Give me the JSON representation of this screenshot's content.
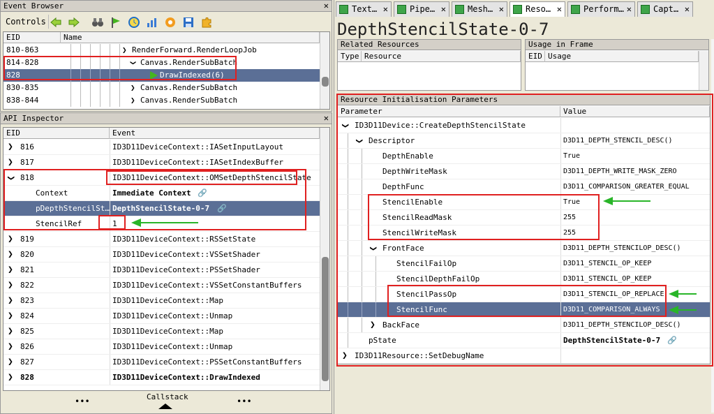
{
  "event_browser": {
    "title": "Event Browser",
    "close": "✕",
    "controls_label": "Controls",
    "columns": [
      "EID",
      "Name"
    ],
    "rows": [
      {
        "eid": "810-863",
        "name": "RenderForward.RenderLoopJob",
        "chev": "❯"
      },
      {
        "eid": "814-828",
        "name": "Canvas.RenderSubBatch",
        "chev": "❯"
      },
      {
        "eid": "828",
        "name": "DrawIndexed(6)"
      },
      {
        "eid": "830-835",
        "name": "Canvas.RenderSubBatch",
        "chev": "❯"
      },
      {
        "eid": "838-844",
        "name": "Canvas.RenderSubBatch",
        "chev": "❯"
      }
    ]
  },
  "api_inspector": {
    "title": "API Inspector",
    "close": "✕",
    "columns": [
      "EID",
      "Event"
    ],
    "rows": [
      {
        "eid": "816",
        "event": "ID3D11DeviceContext::IASetInputLayout"
      },
      {
        "eid": "817",
        "event": "ID3D11DeviceContext::IASetIndexBuffer"
      },
      {
        "eid": "818",
        "event": "ID3D11DeviceContext::OMSetDepthStencilState"
      },
      {
        "param": "Context",
        "value": "Immediate Context"
      },
      {
        "param": "pDepthStencilSt…",
        "value": "DepthStencilState-0-7"
      },
      {
        "param": "StencilRef",
        "value": "1"
      },
      {
        "eid": "819",
        "event": "ID3D11DeviceContext::RSSetState"
      },
      {
        "eid": "820",
        "event": "ID3D11DeviceContext::VSSetShader"
      },
      {
        "eid": "821",
        "event": "ID3D11DeviceContext::PSSetShader"
      },
      {
        "eid": "822",
        "event": "ID3D11DeviceContext::VSSetConstantBuffers"
      },
      {
        "eid": "823",
        "event": "ID3D11DeviceContext::Map"
      },
      {
        "eid": "824",
        "event": "ID3D11DeviceContext::Unmap"
      },
      {
        "eid": "825",
        "event": "ID3D11DeviceContext::Map"
      },
      {
        "eid": "826",
        "event": "ID3D11DeviceContext::Unmap"
      },
      {
        "eid": "827",
        "event": "ID3D11DeviceContext::PSSetConstantBuffers"
      },
      {
        "eid": "828",
        "event": "ID3D11DeviceContext::DrawIndexed"
      }
    ],
    "callstack": "Callstack",
    "dots": "•••"
  },
  "tabs": [
    {
      "label": "Text…",
      "close": "✕"
    },
    {
      "label": "Pipe…",
      "close": "✕"
    },
    {
      "label": "Mesh…",
      "close": "✕"
    },
    {
      "label": "Reso…",
      "close": "✕"
    },
    {
      "label": "Perform…",
      "close": "✕"
    },
    {
      "label": "Capt…",
      "close": "✕"
    }
  ],
  "resource": {
    "name": "DepthStencilState-0-7",
    "related_title": "Related Resources",
    "related_cols": [
      "Type",
      "Resource"
    ],
    "usage_title": "Usage in Frame",
    "usage_cols": [
      "EID",
      "Usage"
    ],
    "init_title": "Resource Initialisation Parameters",
    "init_cols": [
      "Parameter",
      "Value"
    ],
    "params": [
      {
        "param": "ID3D11Device::CreateDepthStencilState",
        "value": ""
      },
      {
        "param": "Descriptor",
        "value": "D3D11_DEPTH_STENCIL_DESC()"
      },
      {
        "param": "DepthEnable",
        "value": "True"
      },
      {
        "param": "DepthWriteMask",
        "value": "D3D11_DEPTH_WRITE_MASK_ZERO"
      },
      {
        "param": "DepthFunc",
        "value": "D3D11_COMPARISON_GREATER_EQUAL"
      },
      {
        "param": "StencilEnable",
        "value": "True"
      },
      {
        "param": "StencilReadMask",
        "value": "255"
      },
      {
        "param": "StencilWriteMask",
        "value": "255"
      },
      {
        "param": "FrontFace",
        "value": "D3D11_DEPTH_STENCILOP_DESC()"
      },
      {
        "param": "StencilFailOp",
        "value": "D3D11_STENCIL_OP_KEEP"
      },
      {
        "param": "StencilDepthFailOp",
        "value": "D3D11_STENCIL_OP_KEEP"
      },
      {
        "param": "StencilPassOp",
        "value": "D3D11_STENCIL_OP_REPLACE"
      },
      {
        "param": "StencilFunc",
        "value": "D3D11_COMPARISON_ALWAYS"
      },
      {
        "param": "BackFace",
        "value": "D3D11_DEPTH_STENCILOP_DESC()"
      },
      {
        "param": "pState",
        "value": "DepthStencilState-0-7"
      },
      {
        "param": "ID3D11Resource::SetDebugName",
        "value": ""
      }
    ]
  },
  "colors": {
    "selection": "#5b6f96",
    "highlight": "#e02020",
    "arrow": "#29b529"
  }
}
